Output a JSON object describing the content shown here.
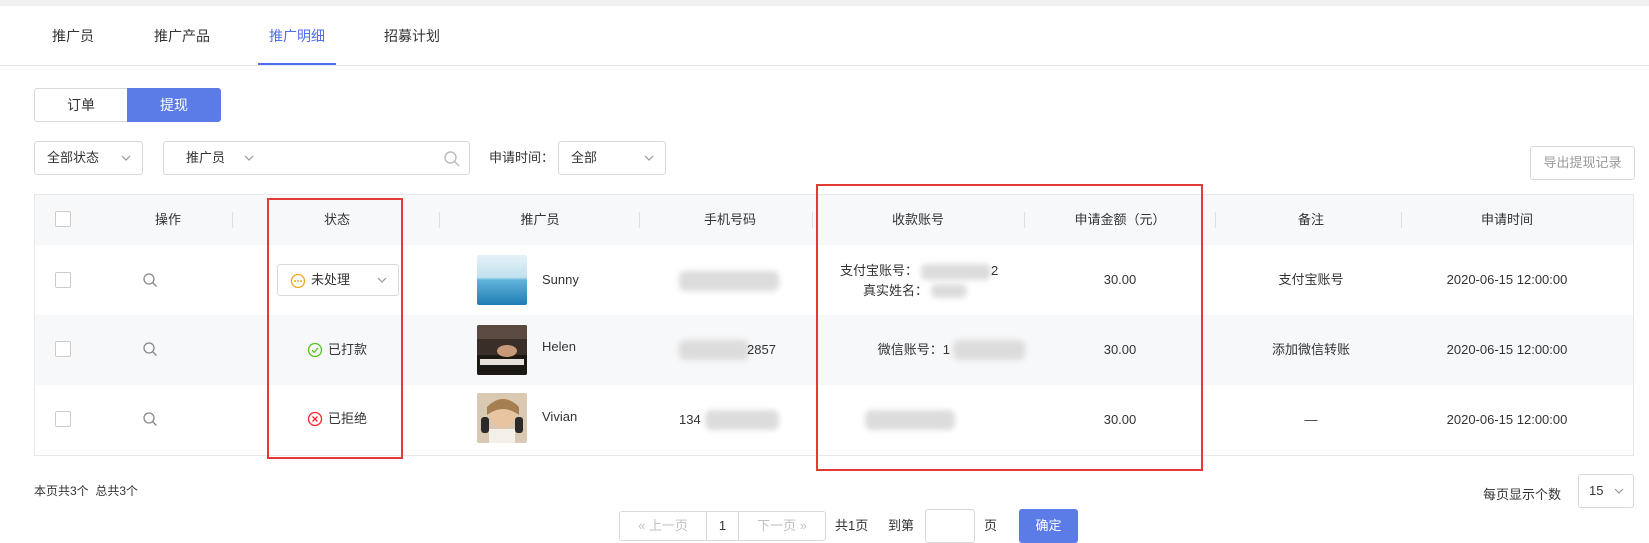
{
  "tabs": [
    {
      "label": "推广员"
    },
    {
      "label": "推广产品"
    },
    {
      "label": "推广明细"
    },
    {
      "label": "招募计划"
    }
  ],
  "active_tab": "推广明细",
  "segments": {
    "order": "订单",
    "withdraw": "提现",
    "active": "提现"
  },
  "filters": {
    "status": "全部状态",
    "search_field": "推广员",
    "search_value": "",
    "time_label": "申请时间：",
    "time_value": "全部"
  },
  "export_label": "导出提现记录",
  "table": {
    "headers": [
      "操作",
      "状态",
      "推广员",
      "手机号码",
      "收款账号",
      "申请金额（元）",
      "备注",
      "申请时间"
    ],
    "rows": [
      {
        "status": "未处理",
        "status_kind": "pending",
        "promoter": "Sunny",
        "phone": "",
        "account_lines": [
          "支付宝账号：",
          "真实姓名："
        ],
        "account_suffix": "2",
        "amount": "30.00",
        "remark": "支付宝账号",
        "time": "2020-06-15 12:00:00"
      },
      {
        "status": "已打款",
        "status_kind": "paid",
        "promoter": "Helen",
        "phone": "2857",
        "account_lines": [
          "微信账号：1"
        ],
        "amount": "30.00",
        "remark": "添加微信转账",
        "time": "2020-06-15 12:00:00"
      },
      {
        "status": "已拒绝",
        "status_kind": "rejected",
        "promoter": "Vivian",
        "phone": "134",
        "account_lines": [
          ""
        ],
        "amount": "30.00",
        "remark": "—",
        "time": "2020-06-15 12:00:00"
      }
    ]
  },
  "footer": {
    "summary": "本页共3个  总共3个",
    "prev": "上一页",
    "page": "1",
    "next": "下一页",
    "total_pages": "共1页",
    "goto": "到第",
    "page_unit": "页",
    "confirm": "确定",
    "per_page_label": "每页显示个数",
    "per_page": "15"
  },
  "colors": {
    "accent": "#5b7ce6",
    "active_tab": "#4e6ef2",
    "highlight": "#e53935",
    "pending": "#f5a623",
    "paid": "#52c41a",
    "rejected": "#f5222d"
  },
  "icons": [
    "search-icon",
    "chevron-down-icon",
    "view-icon",
    "pending-icon",
    "check-circle-icon",
    "close-circle-icon"
  ]
}
